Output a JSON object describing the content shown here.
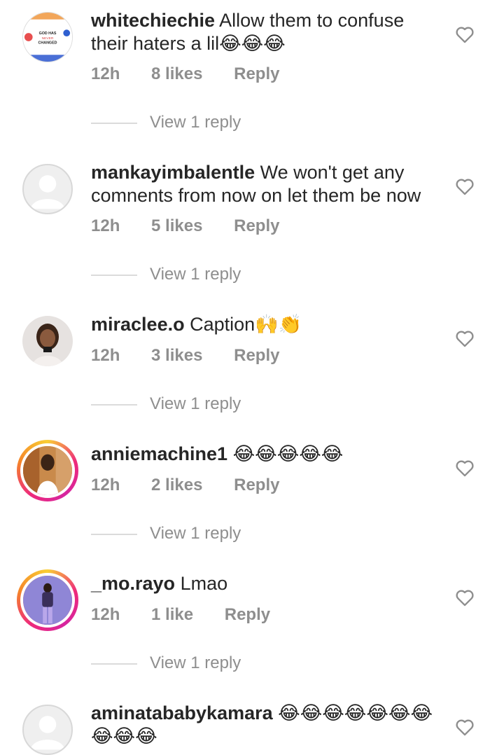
{
  "comments": [
    {
      "username": "whitechiechie",
      "text": "Allow them to confuse their haters a lil😂😂😂",
      "time": "12h",
      "likes": "8 likes",
      "reply": "Reply",
      "view_replies": "View 1 reply",
      "avatar_text": "GOD HAS NEVER CHANGED"
    },
    {
      "username": "mankayimbalentle",
      "text": "We won't get any comnents from now on let them be now",
      "time": "12h",
      "likes": "5 likes",
      "reply": "Reply",
      "view_replies": "View 1 reply"
    },
    {
      "username": "miraclee.o",
      "text": "Caption🙌👏",
      "time": "12h",
      "likes": "3 likes",
      "reply": "Reply",
      "view_replies": "View 1 reply"
    },
    {
      "username": "anniemachine1",
      "text": "😂😂😂😂😂",
      "time": "12h",
      "likes": "2 likes",
      "reply": "Reply",
      "view_replies": "View 1 reply"
    },
    {
      "username": "_mo.rayo",
      "text": "Lmao",
      "time": "12h",
      "likes": "1 like",
      "reply": "Reply",
      "view_replies": "View 1 reply"
    },
    {
      "username": "aminatababykamara",
      "text": "😂😂😂😂😂😂😂😂😂😂"
    }
  ],
  "colors": {
    "text": "#262626",
    "meta": "#8e8e8e",
    "divider": "#dbdbdb",
    "story_ring": "#ee2a7b"
  },
  "icons": {
    "like": "heart-outline-icon"
  }
}
